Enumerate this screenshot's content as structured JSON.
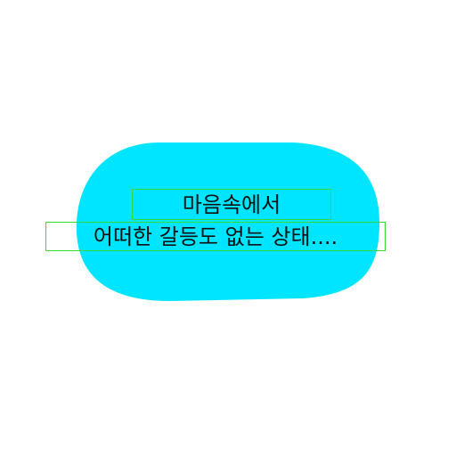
{
  "bubble": {
    "fill_color": "#00e5ff"
  },
  "text": {
    "line_1": "마음속에서",
    "line_2": "어떠한 갈등도 없는 상태....",
    "box_color": "#33dd33"
  }
}
